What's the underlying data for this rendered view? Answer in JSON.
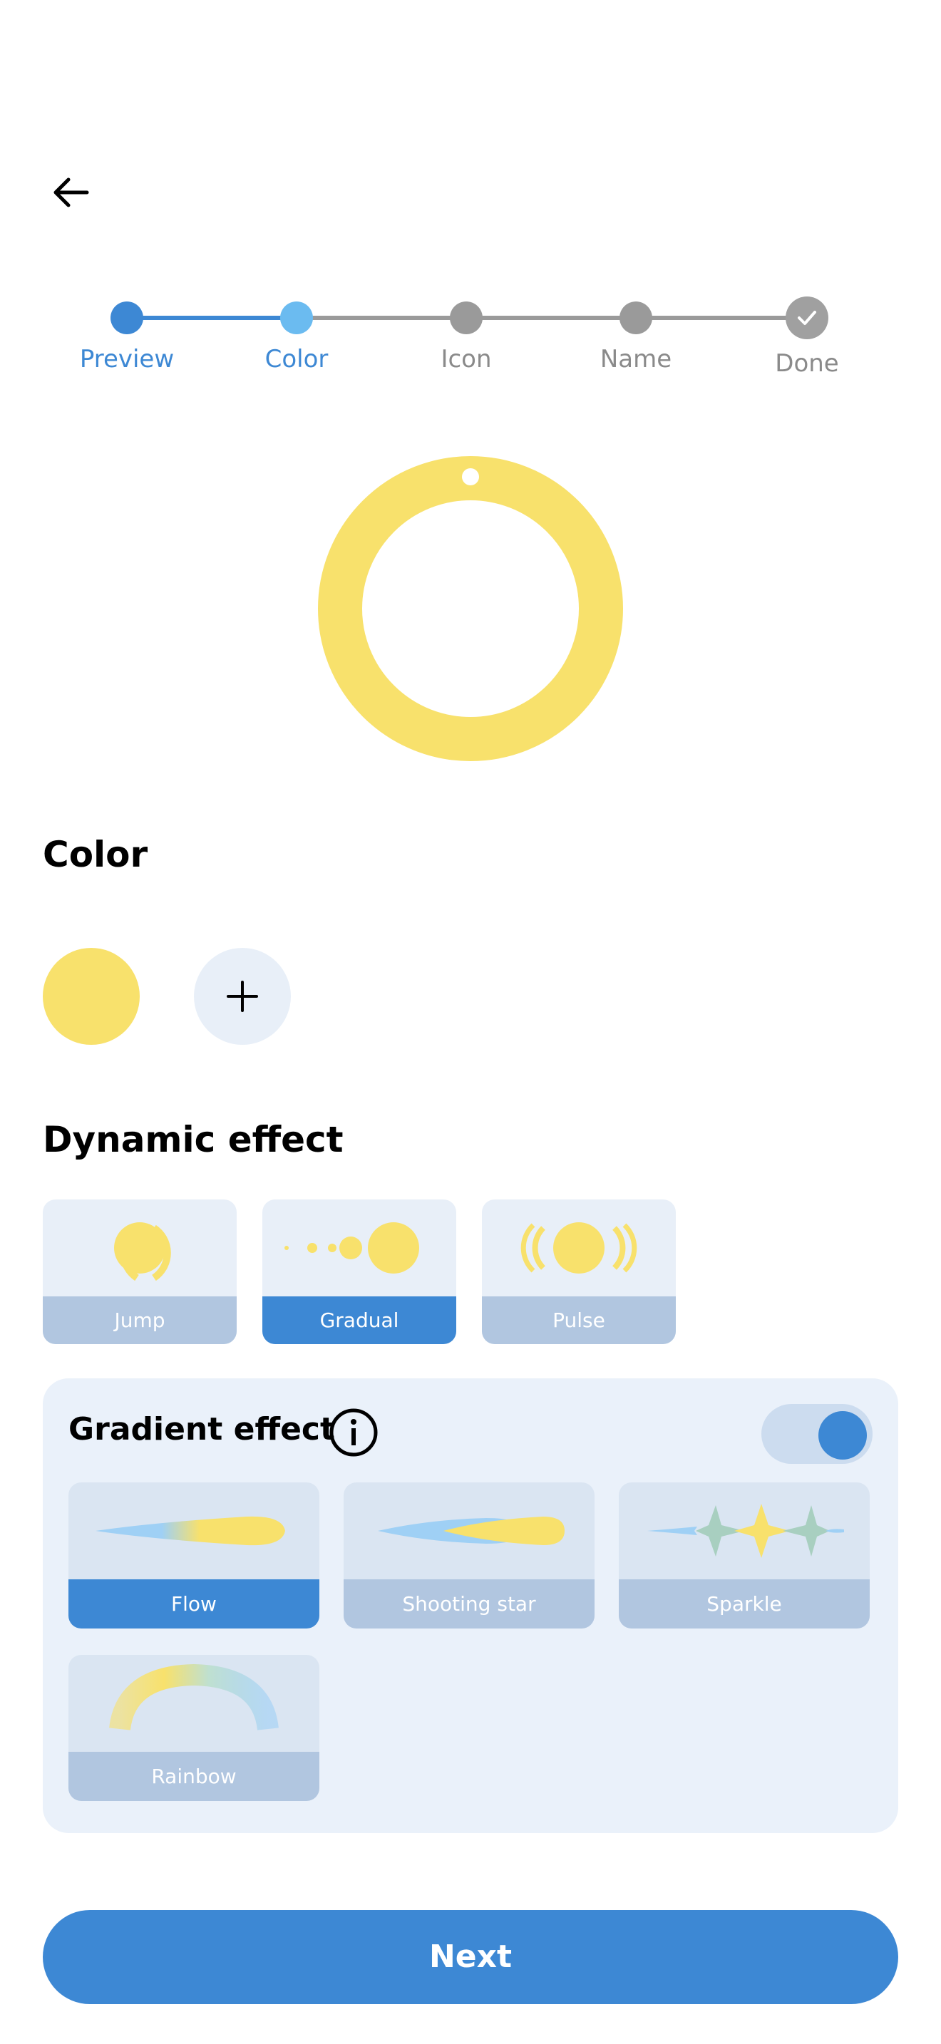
{
  "stepper": {
    "steps": [
      {
        "label": "Preview"
      },
      {
        "label": "Color"
      },
      {
        "label": "Icon"
      },
      {
        "label": "Name"
      },
      {
        "label": "Done"
      }
    ],
    "current_step": 2,
    "colors": {
      "completed": "#3D88D4",
      "current": "#6BBBF0",
      "pending": "#9A9A9A"
    }
  },
  "preview": {
    "ring_color": "#F8E16C"
  },
  "color_section": {
    "title": "Color",
    "selected_color": "#F8E16C",
    "add_icon": "plus-icon"
  },
  "dynamic_effect": {
    "title": "Dynamic effect",
    "options": [
      {
        "label": "Jump",
        "selected": false
      },
      {
        "label": "Gradual",
        "selected": true
      },
      {
        "label": "Pulse",
        "selected": false
      }
    ]
  },
  "gradient_effect": {
    "title": "Gradient effect",
    "info_icon": "info-icon",
    "enabled": true,
    "options": [
      {
        "label": "Flow",
        "selected": true
      },
      {
        "label": "Shooting star",
        "selected": false
      },
      {
        "label": "Sparkle",
        "selected": false
      },
      {
        "label": "Rainbow",
        "selected": false
      }
    ]
  },
  "next_button": {
    "label": "Next"
  },
  "theme": {
    "accent": "#3D88D4",
    "yellow": "#F8E16C",
    "light_blue": "#9FD0F5"
  }
}
